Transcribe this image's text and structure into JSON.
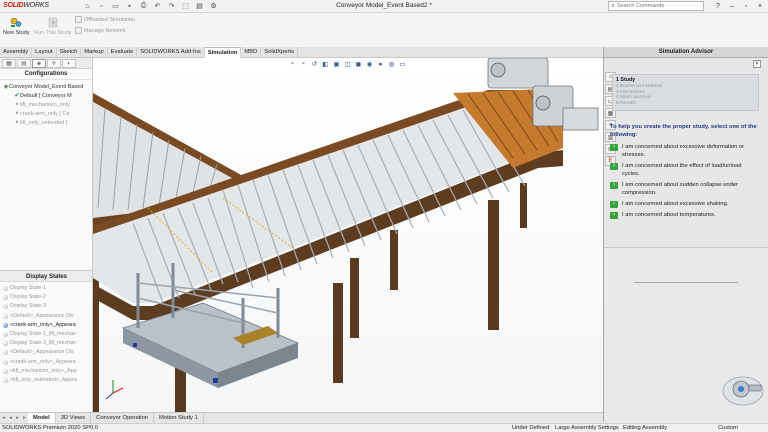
{
  "app": {
    "logo_brand": "SOLID",
    "logo_rest": "WORKS",
    "document_title": "Conveyor Model_Event Based2 *",
    "search_placeholder": "Search Commands"
  },
  "ribbon": {
    "new_study": "New Study",
    "run_study": "Run This Study",
    "offloaded_simulation": "Offloaded Simulation",
    "manage_network": "Manage Network"
  },
  "command_tabs": [
    "Assembly",
    "Layout",
    "Sketch",
    "Markup",
    "Evaluate",
    "SOLIDWORKS Add-Ins",
    "Simulation",
    "MBD",
    "SolidXperts"
  ],
  "active_command_tab": "Simulation",
  "left_panel": {
    "configurations_title": "Configurations",
    "tree": [
      {
        "label": "Conveyor Model_Event Based",
        "dim": false
      },
      {
        "label": "Default [ Conveyor M",
        "dim": false
      },
      {
        "label": "lift_mechanism_only",
        "dim": true
      },
      {
        "label": "crank-arm_only [ Co",
        "dim": true
      },
      {
        "label": "lift_only_extended [",
        "dim": true
      }
    ],
    "display_states_title": "Display States",
    "display_states": [
      "Display State-1",
      "Display State-2",
      "Display State-3",
      "<Default>_Appearance Dis",
      "<crank-arm_only>_Appeara",
      "Display State-1_lift_mechan",
      "Display State-3_lift_mechan",
      "<Default>_Appearance Dis",
      "<crank-arm_only>_Appeara",
      "<lift_mechanism_only>_App",
      "<lift_only_extended>_Appea"
    ],
    "current_display_state_index": 4
  },
  "advisor": {
    "title": "Simulation Advisor",
    "steps": [
      "1 Study",
      "2 Bodies and Material",
      "3 Interactions",
      "4 Mesh and Run",
      "5 Results"
    ],
    "intro": "To help you create the proper study, select one of the following:",
    "options": [
      "I am concerned about excessive deformation or stresses.",
      "I am concerned about the effect of load/unload cycles.",
      "I am concerned about sudden collapse under compression.",
      "I am concerned about excessive shaking.",
      "I am concerned about temperatures."
    ]
  },
  "bottom_tabs": [
    "Model",
    "3D Views",
    "Conveyor Operation",
    "Motion Study 1"
  ],
  "active_bottom_tab": "Model",
  "status_bar": {
    "version": "SOLIDWORKS Premium 2020 SP0.0",
    "under_defined": "Under Defined",
    "large_assembly": "Large Assembly Settings",
    "editing": "Editing Assembly",
    "units": "Custom"
  },
  "colors": {
    "brand_red": "#d81e05",
    "advisor_heading": "#1c3c80",
    "option_check": "#34a53a",
    "frame_wood": "#5e3c1f",
    "roller": "#c9ced3"
  }
}
